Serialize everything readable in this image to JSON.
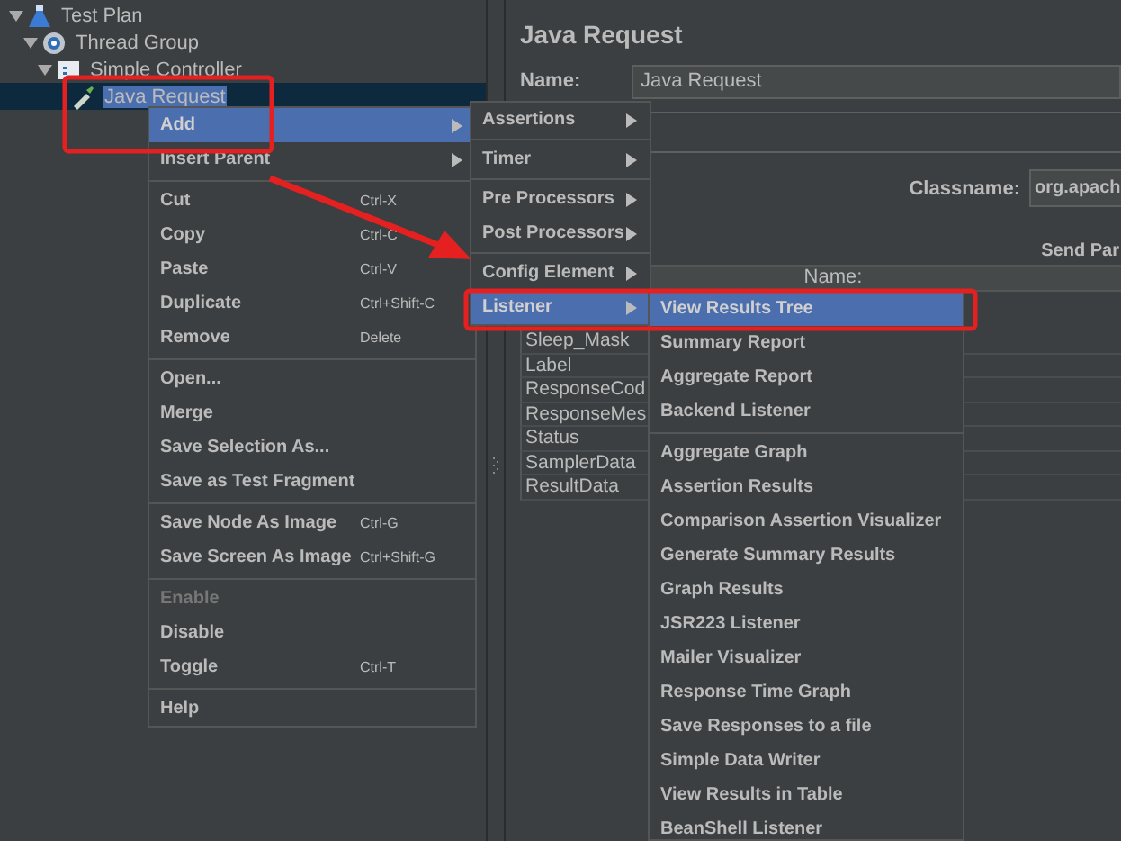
{
  "tree": [
    {
      "label": "Test Plan",
      "kind": "plan",
      "expanded": true,
      "selected": false,
      "children": [
        {
          "label": "Thread Group",
          "kind": "threads",
          "expanded": true,
          "selected": false,
          "children": [
            {
              "label": "Simple Controller",
              "kind": "controller",
              "expanded": true,
              "selected": false,
              "children": [
                {
                  "label": "Java Request",
                  "kind": "sampler",
                  "selected": true
                }
              ]
            }
          ]
        }
      ]
    }
  ],
  "editor": {
    "title": "Java Request",
    "name_label": "Name:",
    "name_value": "Java Request",
    "classname_label": "Classname:",
    "classname_value": "org.apach",
    "send_label": "Send Par",
    "table": {
      "column": "Name:",
      "rows": [
        "Sleep_Mask",
        "Label",
        "ResponseCod",
        "ResponseMes",
        "Status",
        "SamplerData",
        "ResultData"
      ]
    }
  },
  "context_menu": [
    {
      "kind": "item",
      "label": "Add",
      "submenu": true,
      "selected": true,
      "disabled": false
    },
    {
      "kind": "item",
      "label": "Insert Parent",
      "submenu": true,
      "selected": false,
      "disabled": false
    },
    {
      "kind": "separator"
    },
    {
      "kind": "item",
      "label": "Cut",
      "shortcut": "Ctrl-X",
      "selected": false,
      "disabled": false
    },
    {
      "kind": "item",
      "label": "Copy",
      "shortcut": "Ctrl-C",
      "selected": false,
      "disabled": false
    },
    {
      "kind": "item",
      "label": "Paste",
      "shortcut": "Ctrl-V",
      "selected": false,
      "disabled": false
    },
    {
      "kind": "item",
      "label": "Duplicate",
      "shortcut": "Ctrl+Shift-C",
      "selected": false,
      "disabled": false
    },
    {
      "kind": "item",
      "label": "Remove",
      "shortcut": "Delete",
      "selected": false,
      "disabled": false
    },
    {
      "kind": "separator"
    },
    {
      "kind": "item",
      "label": "Open...",
      "selected": false,
      "disabled": false
    },
    {
      "kind": "item",
      "label": "Merge",
      "selected": false,
      "disabled": false
    },
    {
      "kind": "item",
      "label": "Save Selection As...",
      "selected": false,
      "disabled": false
    },
    {
      "kind": "item",
      "label": "Save as Test Fragment",
      "selected": false,
      "disabled": false
    },
    {
      "kind": "separator"
    },
    {
      "kind": "item",
      "label": "Save Node As Image",
      "shortcut": "Ctrl-G",
      "selected": false,
      "disabled": false
    },
    {
      "kind": "item",
      "label": "Save Screen As Image",
      "shortcut": "Ctrl+Shift-G",
      "selected": false,
      "disabled": false
    },
    {
      "kind": "separator"
    },
    {
      "kind": "item",
      "label": "Enable",
      "selected": false,
      "disabled": true
    },
    {
      "kind": "item",
      "label": "Disable",
      "selected": false,
      "disabled": false
    },
    {
      "kind": "item",
      "label": "Toggle",
      "shortcut": "Ctrl-T",
      "selected": false,
      "disabled": false
    },
    {
      "kind": "separator"
    },
    {
      "kind": "item",
      "label": "Help",
      "selected": false,
      "disabled": false
    }
  ],
  "add_menu": [
    {
      "kind": "item",
      "label": "Assertions",
      "submenu": true,
      "selected": false,
      "disabled": false
    },
    {
      "kind": "separator"
    },
    {
      "kind": "item",
      "label": "Timer",
      "submenu": true,
      "selected": false,
      "disabled": false
    },
    {
      "kind": "separator"
    },
    {
      "kind": "item",
      "label": "Pre Processors",
      "submenu": true,
      "selected": false,
      "disabled": false
    },
    {
      "kind": "item",
      "label": "Post Processors",
      "submenu": true,
      "selected": false,
      "disabled": false
    },
    {
      "kind": "separator"
    },
    {
      "kind": "item",
      "label": "Config Element",
      "submenu": true,
      "selected": false,
      "disabled": false
    },
    {
      "kind": "item",
      "label": "Listener",
      "submenu": true,
      "selected": true,
      "disabled": false
    }
  ],
  "listener_menu": [
    {
      "kind": "item",
      "label": "View Results Tree",
      "selected": true,
      "disabled": false
    },
    {
      "kind": "item",
      "label": "Summary Report",
      "selected": false,
      "disabled": false
    },
    {
      "kind": "item",
      "label": "Aggregate Report",
      "selected": false,
      "disabled": false
    },
    {
      "kind": "item",
      "label": "Backend Listener",
      "selected": false,
      "disabled": false
    },
    {
      "kind": "separator"
    },
    {
      "kind": "item",
      "label": "Aggregate Graph",
      "selected": false,
      "disabled": false
    },
    {
      "kind": "item",
      "label": "Assertion Results",
      "selected": false,
      "disabled": false
    },
    {
      "kind": "item",
      "label": "Comparison Assertion Visualizer",
      "selected": false,
      "disabled": false
    },
    {
      "kind": "item",
      "label": "Generate Summary Results",
      "selected": false,
      "disabled": false
    },
    {
      "kind": "item",
      "label": "Graph Results",
      "selected": false,
      "disabled": false
    },
    {
      "kind": "item",
      "label": "JSR223 Listener",
      "selected": false,
      "disabled": false
    },
    {
      "kind": "item",
      "label": "Mailer Visualizer",
      "selected": false,
      "disabled": false
    },
    {
      "kind": "item",
      "label": "Response Time Graph",
      "selected": false,
      "disabled": false
    },
    {
      "kind": "item",
      "label": "Save Responses to a file",
      "selected": false,
      "disabled": false
    },
    {
      "kind": "item",
      "label": "Simple Data Writer",
      "selected": false,
      "disabled": false
    },
    {
      "kind": "item",
      "label": "View Results in Table",
      "selected": false,
      "disabled": false
    },
    {
      "kind": "item",
      "label": "BeanShell Listener",
      "selected": false,
      "disabled": false
    }
  ]
}
